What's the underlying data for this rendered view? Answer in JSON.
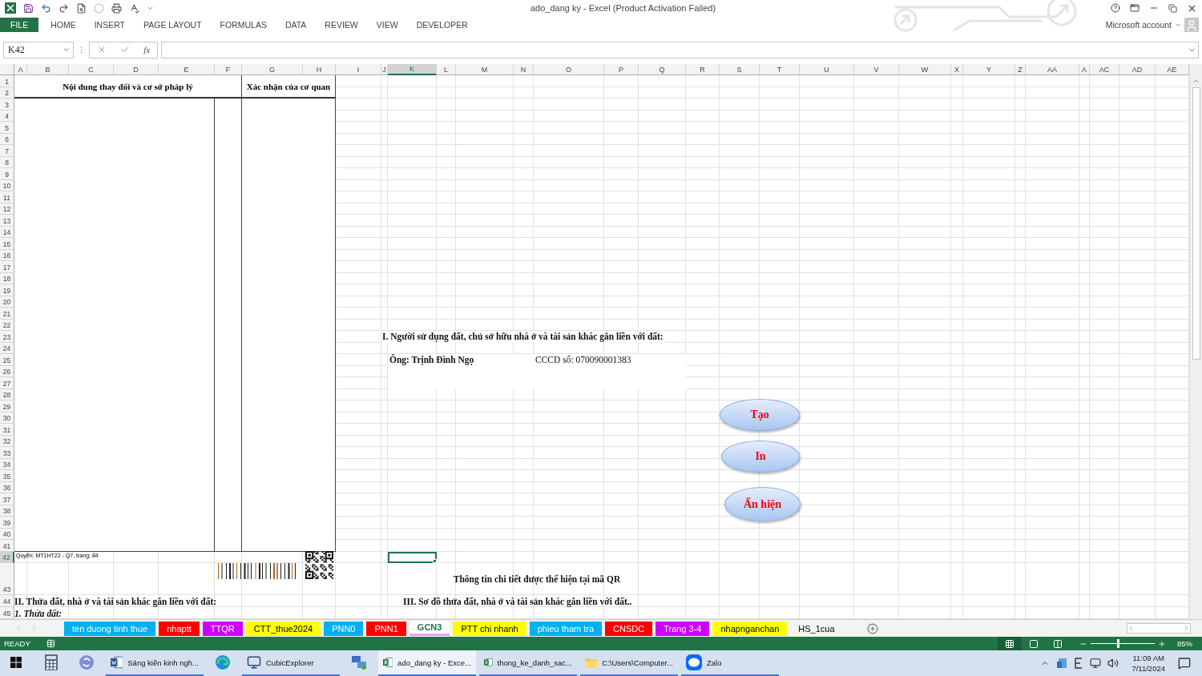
{
  "window": {
    "title": "ado_dang ky - Excel (Product Activation Failed)",
    "account": "Microsoft account"
  },
  "ribbon_tabs": [
    {
      "label": "FILE",
      "kind": "file"
    },
    {
      "label": "HOME",
      "kind": "tab"
    },
    {
      "label": "INSERT",
      "kind": "tab"
    },
    {
      "label": "PAGE LAYOUT",
      "kind": "tab"
    },
    {
      "label": "FORMULAS",
      "kind": "tab"
    },
    {
      "label": "DATA",
      "kind": "tab"
    },
    {
      "label": "REVIEW",
      "kind": "tab"
    },
    {
      "label": "VIEW",
      "kind": "tab"
    },
    {
      "label": "DEVELOPER",
      "kind": "tab"
    }
  ],
  "formula_bar": {
    "name_box": "K42",
    "function_label": "fx"
  },
  "columns": [
    {
      "label": "A",
      "selected": false
    },
    {
      "label": "B",
      "selected": false
    },
    {
      "label": "C",
      "selected": false
    },
    {
      "label": "D",
      "selected": false
    },
    {
      "label": "E",
      "selected": false
    },
    {
      "label": "F",
      "selected": false
    },
    {
      "label": "G",
      "selected": false
    },
    {
      "label": "H",
      "selected": false
    },
    {
      "label": "I",
      "selected": false
    },
    {
      "label": "J",
      "selected": false
    },
    {
      "label": "K",
      "selected": true
    },
    {
      "label": "L",
      "selected": false
    },
    {
      "label": "M",
      "selected": false
    },
    {
      "label": "N",
      "selected": false
    },
    {
      "label": "O",
      "selected": false
    },
    {
      "label": "P",
      "selected": false
    },
    {
      "label": "Q",
      "selected": false
    },
    {
      "label": "R",
      "selected": false
    },
    {
      "label": "S",
      "selected": false
    },
    {
      "label": "T",
      "selected": false
    },
    {
      "label": "U",
      "selected": false
    },
    {
      "label": "V",
      "selected": false
    },
    {
      "label": "W",
      "selected": false
    },
    {
      "label": "X",
      "selected": false
    },
    {
      "label": "Y",
      "selected": false
    },
    {
      "label": "Z",
      "selected": false
    },
    {
      "label": "AA",
      "selected": false
    },
    {
      "label": "A",
      "selected": false
    },
    {
      "label": "AC",
      "selected": false
    },
    {
      "label": "AD",
      "selected": false
    },
    {
      "label": "AE",
      "selected": false
    }
  ],
  "rows": [
    {
      "label": "1",
      "selected": false
    },
    {
      "label": "2",
      "selected": false
    },
    {
      "label": "3",
      "selected": false
    },
    {
      "label": "4",
      "selected": false
    },
    {
      "label": "5",
      "selected": false
    },
    {
      "label": "6",
      "selected": false
    },
    {
      "label": "7",
      "selected": false
    },
    {
      "label": "8",
      "selected": false
    },
    {
      "label": "9",
      "selected": false
    },
    {
      "label": "10",
      "selected": false
    },
    {
      "label": "11",
      "selected": false
    },
    {
      "label": "12",
      "selected": false
    },
    {
      "label": "13",
      "selected": false
    },
    {
      "label": "14",
      "selected": false
    },
    {
      "label": "15",
      "selected": false
    },
    {
      "label": "16",
      "selected": false
    },
    {
      "label": "17",
      "selected": false
    },
    {
      "label": "18",
      "selected": false
    },
    {
      "label": "19",
      "selected": false
    },
    {
      "label": "20",
      "selected": false
    },
    {
      "label": "21",
      "selected": false
    },
    {
      "label": "22",
      "selected": false
    },
    {
      "label": "23",
      "selected": false
    },
    {
      "label": "24",
      "selected": false
    },
    {
      "label": "25",
      "selected": false
    },
    {
      "label": "26",
      "selected": false
    },
    {
      "label": "27",
      "selected": false
    },
    {
      "label": "28",
      "selected": false
    },
    {
      "label": "29",
      "selected": false
    },
    {
      "label": "30",
      "selected": false
    },
    {
      "label": "31",
      "selected": false
    },
    {
      "label": "32",
      "selected": false
    },
    {
      "label": "33",
      "selected": false
    },
    {
      "label": "34",
      "selected": false
    },
    {
      "label": "35",
      "selected": false
    },
    {
      "label": "36",
      "selected": false
    },
    {
      "label": "37",
      "selected": false
    },
    {
      "label": "38",
      "selected": false
    },
    {
      "label": "39",
      "selected": false
    },
    {
      "label": "40",
      "selected": false
    },
    {
      "label": "41",
      "selected": false
    },
    {
      "label": "42",
      "selected": true
    },
    {
      "label": "43",
      "selected": false
    },
    {
      "label": "44",
      "selected": false
    },
    {
      "label": "45",
      "selected": false
    }
  ],
  "left_table": {
    "header_left": "Nội dung thay đổi và cơ sở pháp lý",
    "header_right": "Xác nhận của cơ quan"
  },
  "book_note": "Quyển: MT1HT22 - Q7, trang: 84",
  "section_1": {
    "title": "I. Người sử dụng đất, chủ sở hữu nhà ở và tài sản khác gắn liền với đất:",
    "owner": "Ông: Trịnh Đình Ngọ",
    "id_number": "CCCD số: 070090001383"
  },
  "qr_caption": "Thông tin chi tiết được thể hiện tại mã QR",
  "section_2": {
    "title": "II. Thửa đất, nhà ở và tài sản khác gắn liền với đất:",
    "subtitle": "1. Thửa đất:"
  },
  "section_3_title": "III. Sơ đồ thửa đất, nhà ở và tài sản khác gắn liền với đất..",
  "macro_buttons": [
    "Tạo",
    "In",
    "Ấn hiện"
  ],
  "sheet_tabs": [
    {
      "label": "ten duong tinh thue",
      "color": "#00b0f0",
      "selected": false
    },
    {
      "label": "nhaptt",
      "color": "#ff0000",
      "selected": false
    },
    {
      "label": "TTQR",
      "color": "#cc00ff",
      "selected": false
    },
    {
      "label": "CTT_thue2024",
      "color": "#ffff00",
      "selected": false
    },
    {
      "label": "PNN0",
      "color": "#00b0f0",
      "selected": false
    },
    {
      "label": "PNN1",
      "color": "#ff0000",
      "selected": false
    },
    {
      "label": "GCN3",
      "color": "#e2a6f2",
      "selected": true
    },
    {
      "label": "PTT chi nhanh",
      "color": "#ffff00",
      "selected": false
    },
    {
      "label": "phieu tham tra",
      "color": "#00b0f0",
      "selected": false
    },
    {
      "label": "CNSDC",
      "color": "#ff0000",
      "selected": false
    },
    {
      "label": "Trang 3-4",
      "color": "#cc00ff",
      "selected": false
    },
    {
      "label": "nhapnganchan",
      "color": "#ffff00",
      "selected": false
    },
    {
      "label": "HS_1cua",
      "selected": false
    }
  ],
  "status_bar": {
    "mode": "READY",
    "view_buttons": [
      {
        "kind": "normal",
        "selected": true
      },
      {
        "kind": "page_layout",
        "selected": false
      },
      {
        "kind": "page_break",
        "selected": false
      }
    ],
    "zoom_slider": {
      "level": 0.42
    },
    "zoom": "85%"
  },
  "taskbar": {
    "items": [
      {
        "kind": "start",
        "selected": false
      },
      {
        "kind": "calculator",
        "selected": false
      },
      {
        "kind": "sync",
        "selected": false
      },
      {
        "kind": "word",
        "label": "Sáng kiến kinh ngh...",
        "selected": false
      },
      {
        "kind": "edge",
        "selected": false
      },
      {
        "kind": "computer",
        "label": "CubicExplorer",
        "selected": false
      },
      {
        "kind": "network",
        "selected": false
      },
      {
        "kind": "excel",
        "label": "ado_dang ky - Exce...",
        "selected": true
      },
      {
        "kind": "excel",
        "label": "thong_ke_danh_sac...",
        "selected": false
      },
      {
        "kind": "folder",
        "label": "C:\\Users\\Computer...",
        "selected": false
      },
      {
        "kind": "zalo",
        "label": "Zalo",
        "selected": false
      }
    ],
    "time": "11:09 AM",
    "date": "7/11/2024"
  }
}
